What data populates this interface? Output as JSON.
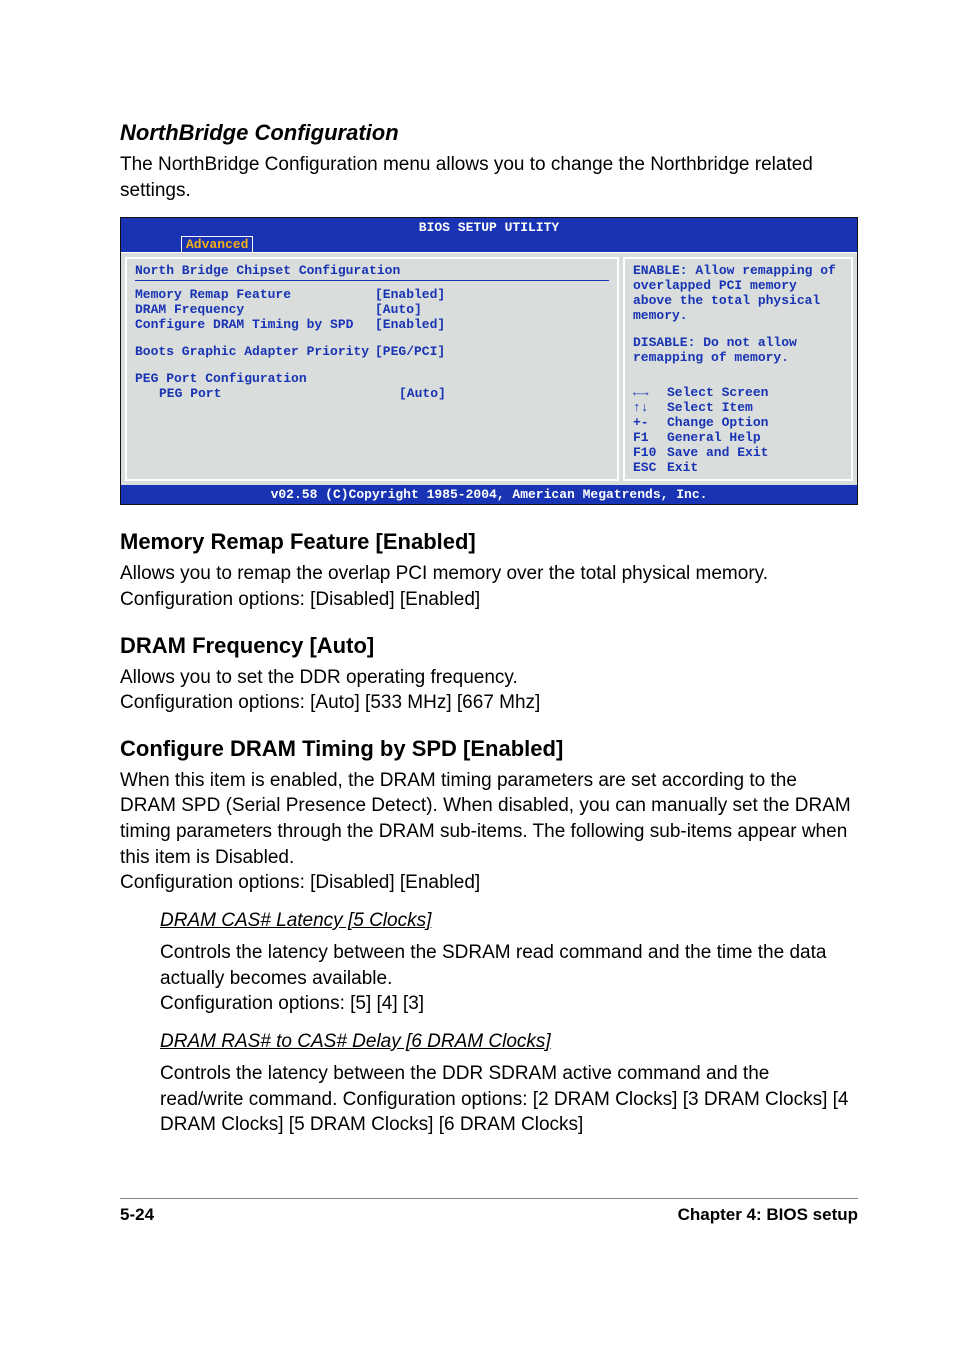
{
  "section1": {
    "title": "NorthBridge Configuration",
    "body": "The NorthBridge Configuration menu allows you to change the Northbridge related settings."
  },
  "bios": {
    "titlebar": "BIOS SETUP UTILITY",
    "tab": "Advanced",
    "left_heading": "North Bridge Chipset Configuration",
    "rows": [
      {
        "label": "Memory Remap Feature",
        "value": "[Enabled]"
      },
      {
        "label": "DRAM Frequency",
        "value": "[Auto]"
      },
      {
        "label": "Configure DRAM Timing by SPD",
        "value": "[Enabled]"
      }
    ],
    "row_boots": {
      "label": "Boots Graphic Adapter Priority",
      "value": "[PEG/PCI]"
    },
    "peg_heading": "PEG Port Configuration",
    "peg_row": {
      "label": "PEG Port",
      "value": "[Auto]"
    },
    "help1": "ENABLE: Allow remapping of overlapped PCI memory above the total physical memory.",
    "help2": "DISABLE: Do not allow remapping of memory.",
    "nav": [
      {
        "sym": "←→",
        "text": "Select Screen"
      },
      {
        "sym": "↑↓",
        "text": "Select Item"
      },
      {
        "sym": "+-",
        "text": "Change Option"
      },
      {
        "sym": "F1",
        "text": "General Help"
      },
      {
        "sym": "F10",
        "text": "Save and Exit"
      },
      {
        "sym": "ESC",
        "text": "Exit"
      }
    ],
    "footer": "v02.58 (C)Copyright 1985-2004, American Megatrends, Inc."
  },
  "mem_remap": {
    "title": "Memory Remap Feature [Enabled]",
    "body": "Allows you to remap the overlap PCI memory over the total physical memory. Configuration options: [Disabled] [Enabled]"
  },
  "dram_freq": {
    "title": "DRAM Frequency [Auto]",
    "body1": "Allows you to set the DDR operating frequency.",
    "body2": "Configuration options: [Auto] [533 MHz] [667 Mhz]"
  },
  "cfg_dram": {
    "title": "Configure DRAM Timing by SPD [Enabled]",
    "body": "When this item is enabled, the DRAM timing parameters are set according to the DRAM SPD (Serial Presence Detect). When disabled, you can manually set the DRAM timing parameters through the DRAM sub-items. The following sub-items appear when this item is Disabled.",
    "body2": "Configuration options: [Disabled] [Enabled]"
  },
  "sub_cas": {
    "title": "DRAM CAS# Latency [5 Clocks]",
    "body": "Controls the latency between the SDRAM read command and the time the data actually becomes available.",
    "body2": "Configuration options: [5] [4] [3]"
  },
  "sub_ras": {
    "title": "DRAM RAS# to CAS# Delay [6 DRAM Clocks]",
    "body": "Controls the latency between the DDR SDRAM active command and the read/write command. Configuration options: [2 DRAM Clocks] [3 DRAM Clocks] [4 DRAM  Clocks] [5 DRAM Clocks] [6 DRAM Clocks]"
  },
  "footer": {
    "pagenum": "5-24",
    "chapter": "Chapter 4: BIOS setup"
  }
}
